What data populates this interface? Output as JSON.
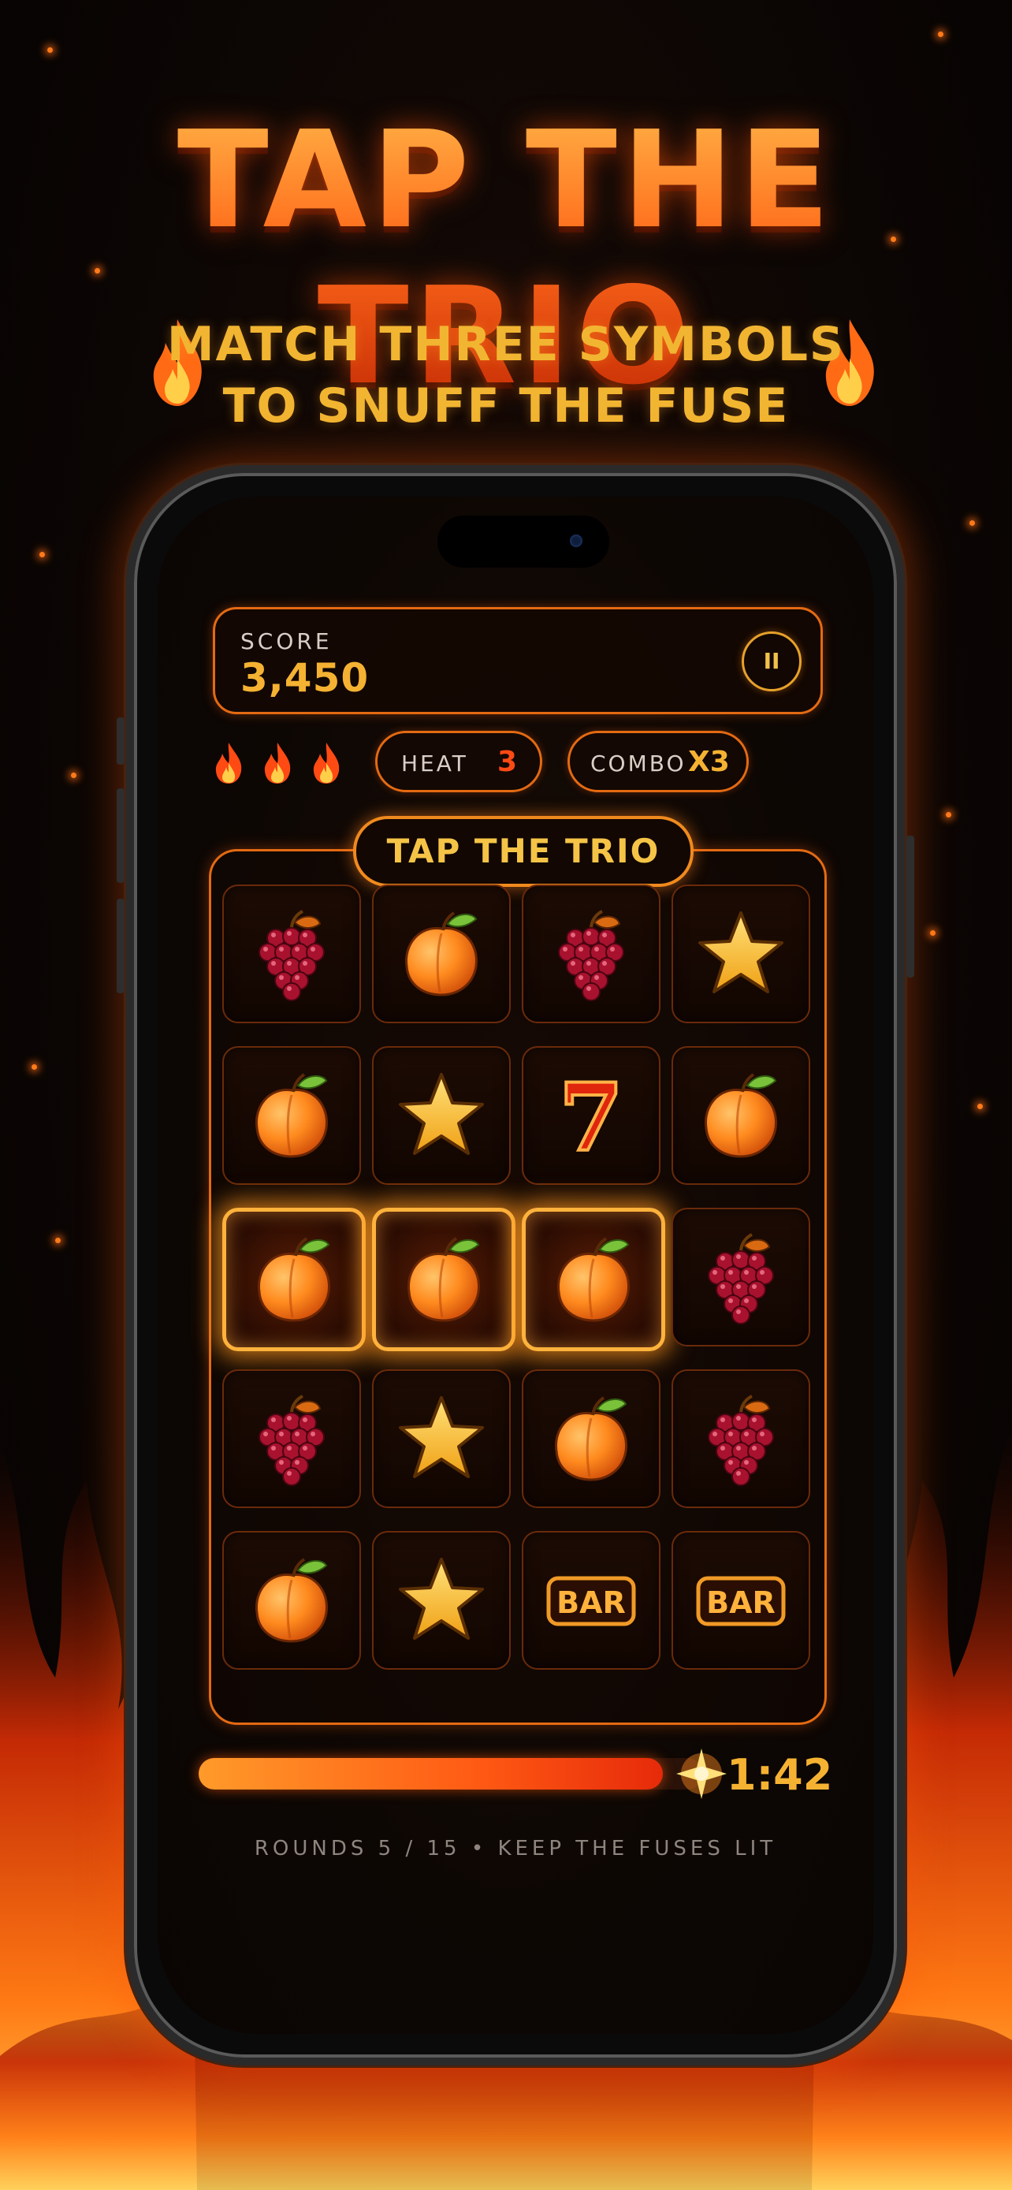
{
  "title": "TAP THE TRIO",
  "subtitle": [
    "MATCH THREE SYMBOLS",
    "TO SNUFF THE FUSE"
  ],
  "colors": {
    "accent": "#ff6a1a",
    "gold": "#f5b232",
    "frame": "#e46a12",
    "heat": "#ff4a14"
  },
  "hud": {
    "score_label": "SCORE",
    "score_value": "3,450",
    "pause_label": "II",
    "lives": 3,
    "heat_label": "HEAT",
    "heat_value": "3",
    "combo_label": "COMBO",
    "combo_value": "X3"
  },
  "board": {
    "title": "TAP THE TRIO",
    "tiles": [
      [
        "grapes",
        "peach",
        "grapes",
        "star"
      ],
      [
        "peach",
        "star",
        "seven",
        "peach"
      ],
      [
        "peach",
        "peach",
        "peach",
        "grapes"
      ],
      [
        "grapes",
        "star",
        "peach",
        "grapes"
      ],
      [
        "peach",
        "star",
        "bar",
        "bar"
      ]
    ],
    "highlighted_row": 2,
    "highlighted_cols": [
      0,
      1,
      2
    ],
    "bar_text": "BAR",
    "seven_text": "7"
  },
  "timer": {
    "value": "1:42",
    "progress": 0.92
  },
  "footer": "ROUNDS  5 / 15   •   KEEP THE FUSES LIT"
}
